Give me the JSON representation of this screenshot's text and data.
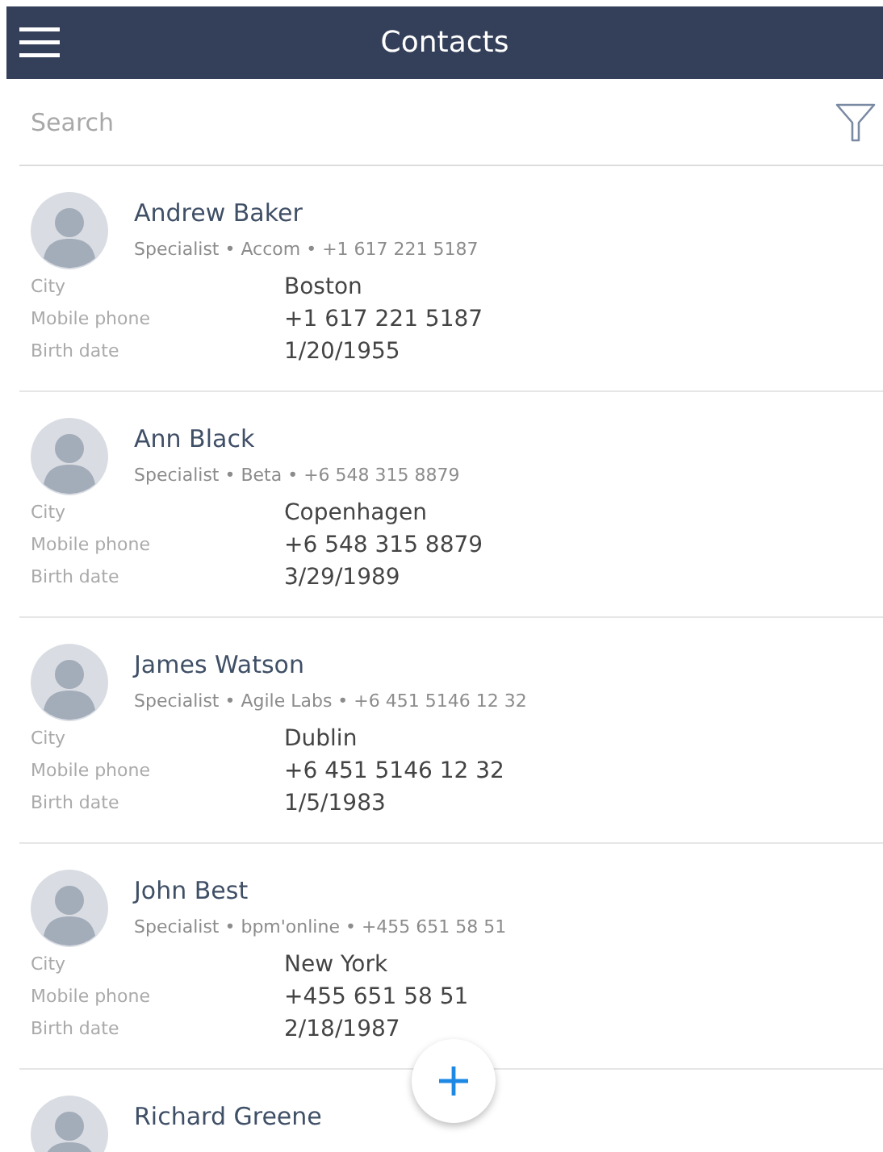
{
  "header": {
    "title": "Contacts"
  },
  "search": {
    "placeholder": "Search"
  },
  "contacts": [
    {
      "name": "Andrew Baker",
      "subtitle": "Specialist • Accom • +1 617 221 5187",
      "fields": [
        {
          "label": "City",
          "value": "Boston"
        },
        {
          "label": "Mobile phone",
          "value": "+1 617 221 5187"
        },
        {
          "label": "Birth date",
          "value": "1/20/1955"
        }
      ]
    },
    {
      "name": "Ann Black",
      "subtitle": "Specialist • Beta • +6 548 315 8879",
      "fields": [
        {
          "label": "City",
          "value": "Copenhagen"
        },
        {
          "label": "Mobile phone",
          "value": "+6 548 315 8879"
        },
        {
          "label": "Birth date",
          "value": "3/29/1989"
        }
      ]
    },
    {
      "name": "James Watson",
      "subtitle": "Specialist • Agile Labs • +6 451 5146 12 32",
      "fields": [
        {
          "label": "City",
          "value": "Dublin"
        },
        {
          "label": "Mobile phone",
          "value": "+6 451 5146 12 32"
        },
        {
          "label": "Birth date",
          "value": "1/5/1983"
        }
      ]
    },
    {
      "name": "John Best",
      "subtitle": "Specialist • bpm'online • +455 651 58 51",
      "fields": [
        {
          "label": "City",
          "value": "New York"
        },
        {
          "label": "Mobile phone",
          "value": "+455 651 58 51"
        },
        {
          "label": "Birth date",
          "value": "2/18/1987"
        }
      ]
    },
    {
      "name": "Richard Greene"
    }
  ]
}
